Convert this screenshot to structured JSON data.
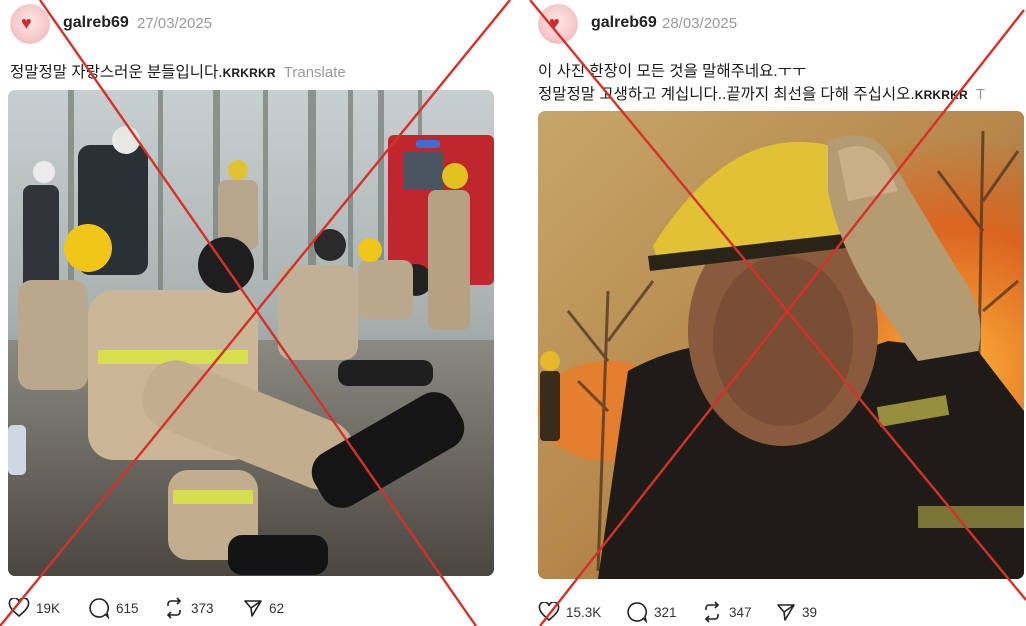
{
  "posts": [
    {
      "username": "galreb69",
      "date": "27/03/2025",
      "caption_text": "정말정말 자랑스러운 분들입니다.",
      "caption_suffix": "KRKRKR",
      "translate_label": "Translate",
      "image_icon": "firefighters-resting-in-rain-photo",
      "metrics": {
        "likes": "19K",
        "comments": "615",
        "reposts": "373",
        "shares": "62"
      }
    },
    {
      "username": "galreb69",
      "date": "28/03/2025",
      "caption_line1": "이 사진 한장이 모든 것을 말해주네요.ㅜㅜ",
      "caption_line2": "정말정말 고생하고 계십니다..끝까지 최선을 다해 주십시오.",
      "caption_suffix": "KRKRKR",
      "translate_label": "T",
      "image_icon": "exhausted-firefighter-wildfire-photo",
      "metrics": {
        "likes": "15.3K",
        "comments": "321",
        "reposts": "347",
        "shares": "39"
      }
    }
  ],
  "colors": {
    "cross_mark": "#d6302a",
    "date_gray": "#9a9a9a",
    "heart_red": "#d62828"
  }
}
